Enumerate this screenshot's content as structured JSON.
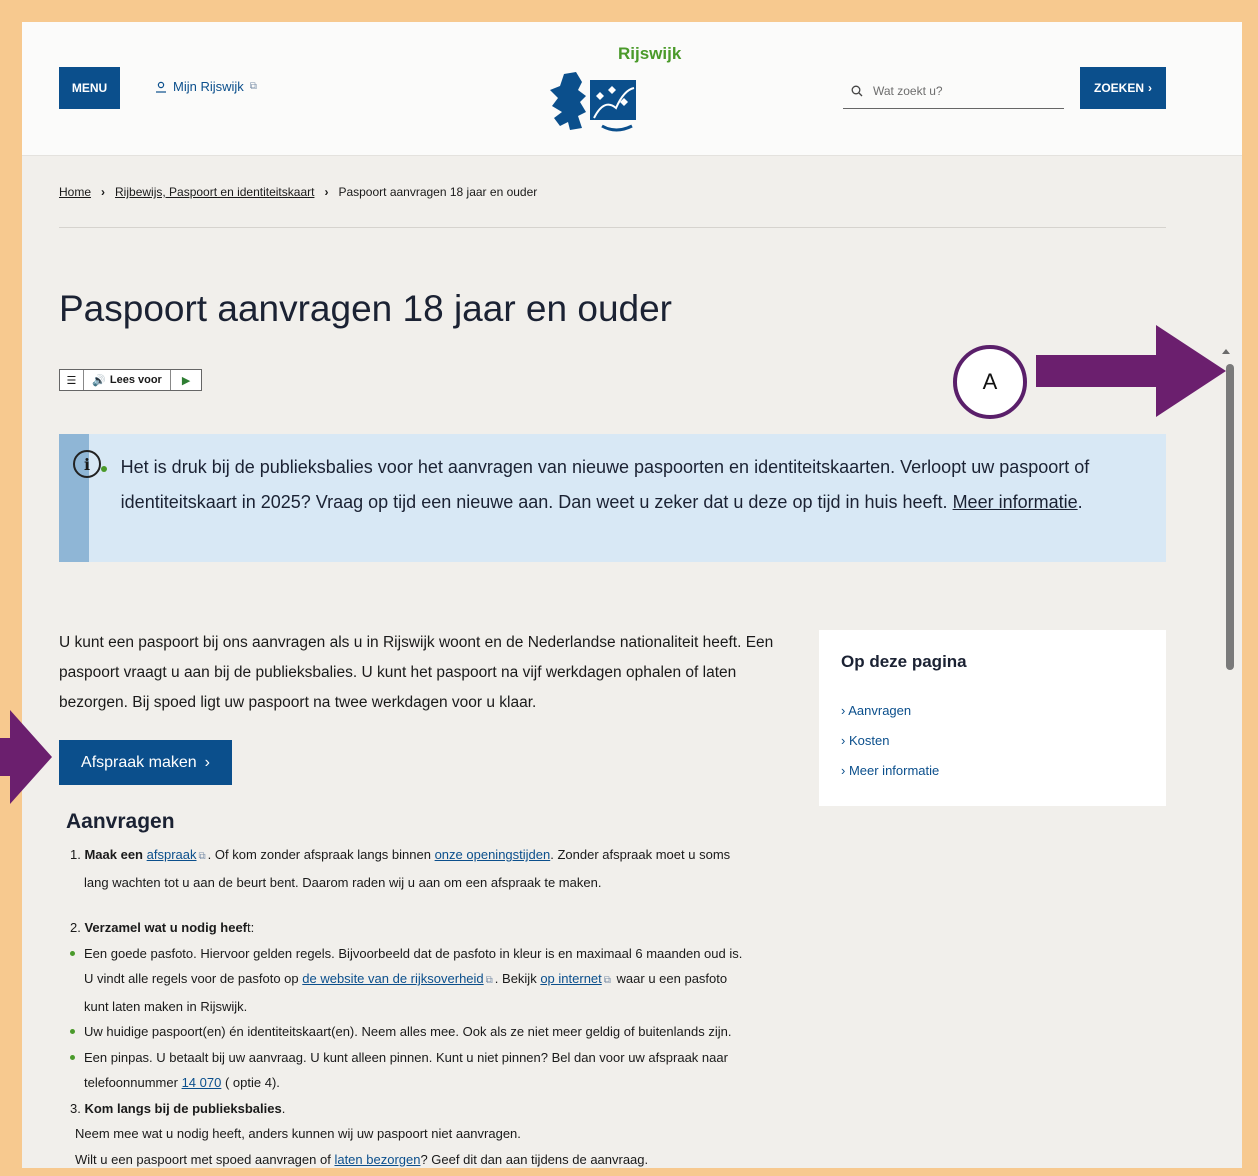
{
  "header": {
    "menu_label": "MENU",
    "mijn_label": "Mijn Rijswijk",
    "logo_text": "Rijswijk",
    "search_placeholder": "Wat zoekt u?",
    "search_button": "ZOEKEN"
  },
  "breadcrumb": {
    "home": "Home",
    "parent": "Rijbewijs, Paspoort en identiteitskaart",
    "current": "Paspoort aanvragen 18 jaar en ouder"
  },
  "page_title": "Paspoort aanvragen 18 jaar en ouder",
  "readspeaker": {
    "label": "Lees voor"
  },
  "info": {
    "text": "Het is druk bij de publieksbalies voor het aanvragen van nieuwe paspoorten en identiteitskaarten. Verloopt uw paspoort of identiteitskaart in 2025? Vraag op tijd een nieuwe aan. Dan weet u zeker dat u deze op tijd in huis heeft.",
    "link": "Meer informatie"
  },
  "intro": "U kunt een paspoort bij ons aanvragen als u in Rijswijk woont en de Nederlandse nationaliteit heeft. Een paspoort vraagt u aan bij de publieksbalies. U kunt het paspoort na vijf werkdagen ophalen of laten bezorgen. Bij spoed ligt uw paspoort na twee werkdagen voor u klaar.",
  "appointment_button": "Afspraak maken",
  "toc": {
    "title": "Op deze pagina",
    "items": [
      "Aanvragen",
      "Kosten",
      "Meer informatie"
    ]
  },
  "section": {
    "title": "Aanvragen",
    "s1_num": "1.",
    "s1_bold": "Maak een",
    "s1_link": "afspraak",
    "s1_rest": ". Of kom zonder afspraak langs binnen",
    "s1_link2": "onze openingstijden",
    "s1_rest2": ". Zonder afspraak moet u soms",
    "s1_line2": "lang wachten tot u aan de beurt bent. Daarom raden wij u aan om een afspraak te maken.",
    "s2_num": "2.",
    "s2_bold": "Verzamel wat u nodig heef",
    "s2_tail": "t:",
    "b1_line1": "Een goede pasfoto. Hiervoor gelden regels. Bijvoorbeeld dat de pasfoto in kleur is en maximaal 6 maanden oud is.",
    "b1_line2_pre": "U vindt alle regels voor de pasfoto op",
    "b1_link1": "de website van de rijksoverheid",
    "b1_line2_mid": ". Bekijk",
    "b1_link2": "op internet",
    "b1_line2_post": "waar u een pasfoto",
    "b1_line3": "kunt laten maken in Rijswijk.",
    "b2": "Uw huidige paspoort(en) én identiteitskaart(en). Neem alles mee. Ook als ze niet meer geldig of buitenlands zijn.",
    "b3_line1": "Een pinpas. U betaalt bij uw aanvraag. U kunt alleen pinnen. Kunt u niet pinnen? Bel dan voor uw afspraak naar",
    "b3_line2_pre": "telefoonnummer",
    "b3_link": "14 070",
    "b3_line2_post": "( optie 4).",
    "s3_num": "3.",
    "s3_bold": "Kom langs bij de publieksbalies",
    "s3_dot": ".",
    "s3_line2": "Neem mee wat u nodig heeft, anders kunnen wij uw paspoort niet aanvragen.",
    "s3_line3_pre": "Wilt u een paspoort met spoed aanvragen of",
    "s3_link": "laten bezorgen",
    "s3_line3_post": "? Geef dit dan aan tijdens de aanvraag."
  },
  "annotation": {
    "marker": "A",
    "color": "#6b1f6e"
  },
  "colors": {
    "brand_blue": "#0b4f8c",
    "logo_green": "#4a9a2a",
    "info_bg": "#d8e8f5"
  }
}
